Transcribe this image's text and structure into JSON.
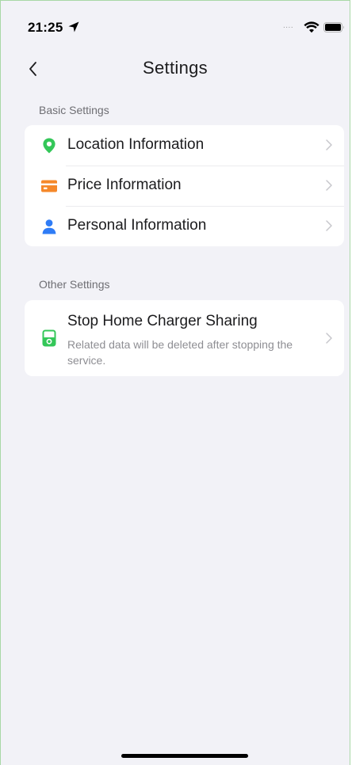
{
  "status_bar": {
    "time": "21:25",
    "signal": "....",
    "icons": [
      "location-arrow-icon",
      "wifi-icon",
      "battery-icon"
    ]
  },
  "nav": {
    "title": "Settings",
    "back_icon": "chevron-left-icon"
  },
  "sections": [
    {
      "header": "Basic Settings",
      "items": [
        {
          "label": "Location Information",
          "icon": "location-pin-icon",
          "icon_color": "#34c759"
        },
        {
          "label": "Price Information",
          "icon": "card-icon",
          "icon_color": "#f5882a"
        },
        {
          "label": "Personal Information",
          "icon": "person-icon",
          "icon_color": "#2f7cf6"
        }
      ]
    },
    {
      "header": "Other Settings",
      "items": [
        {
          "label": "Stop Home Charger Sharing",
          "sublabel": "Related data will be deleted after stopping the service.",
          "icon": "charger-icon",
          "icon_color": "#34c759"
        }
      ]
    }
  ],
  "colors": {
    "background": "#f2f2f7",
    "card": "#ffffff",
    "chevron": "#c7c7cc"
  }
}
